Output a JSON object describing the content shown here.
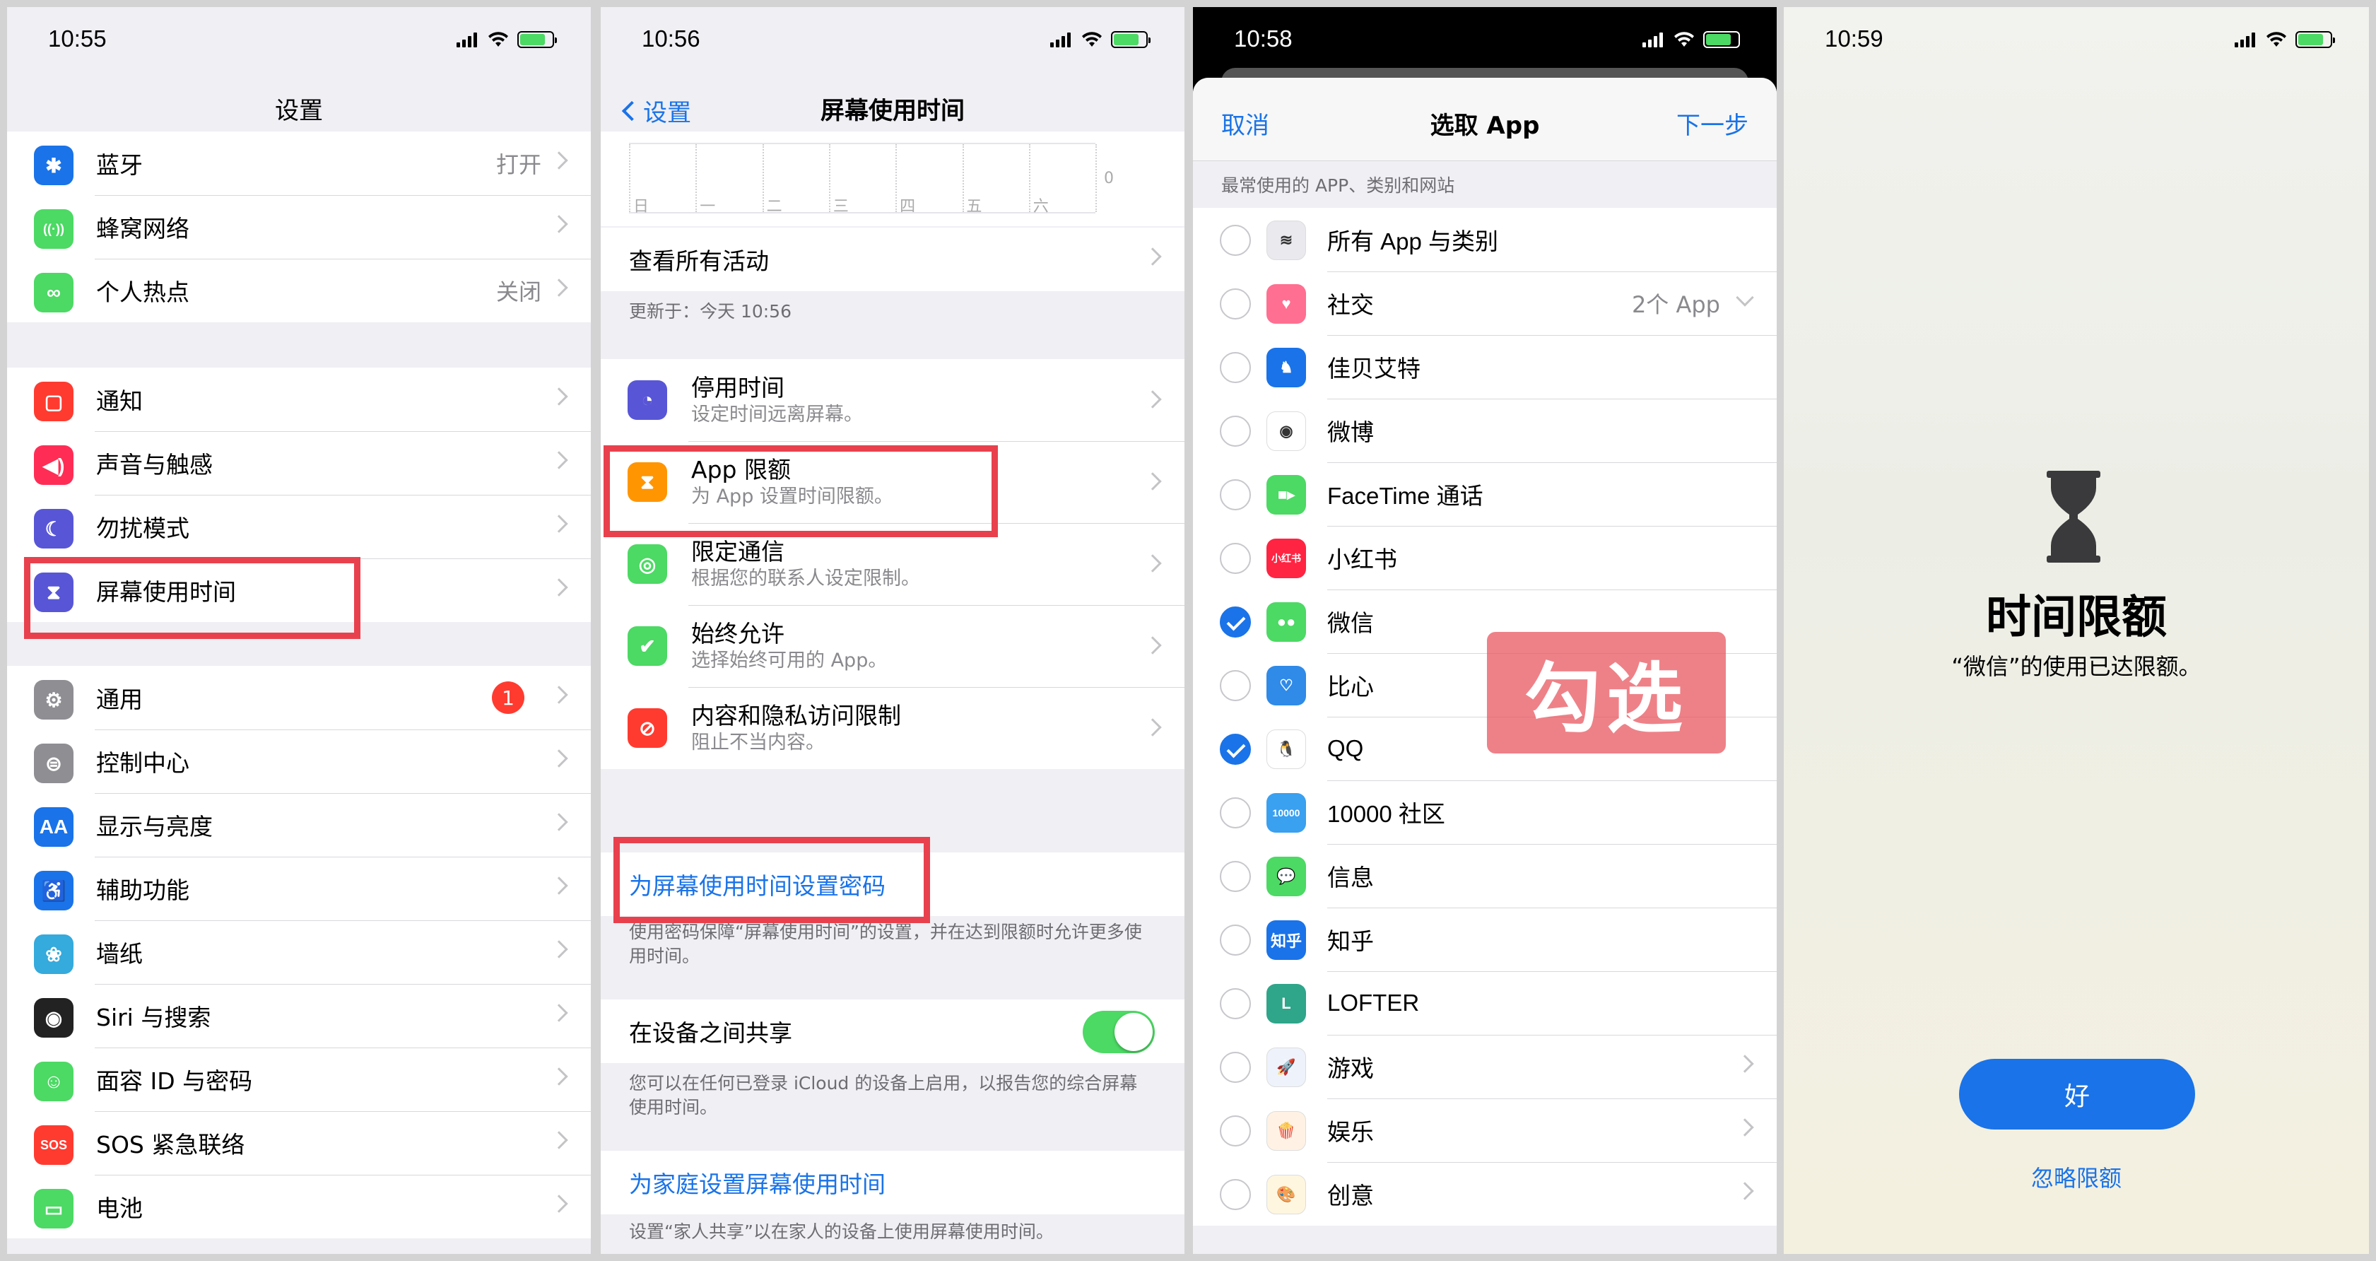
{
  "panel1": {
    "time": "10:55",
    "title": "设置",
    "group1": [
      {
        "label": "蓝牙",
        "value": "打开",
        "color": "#1a73e8",
        "icon": "bluetooth-icon",
        "glyph": "✱"
      },
      {
        "label": "蜂窝网络",
        "value": "",
        "color": "#4cd964",
        "icon": "cellular-icon",
        "glyph": "((·))"
      },
      {
        "label": "个人热点",
        "value": "关闭",
        "color": "#4cd964",
        "icon": "hotspot-icon",
        "glyph": "∞"
      }
    ],
    "group2": [
      {
        "label": "通知",
        "color": "#ff3b30",
        "icon": "notification-icon",
        "glyph": "▢"
      },
      {
        "label": "声音与触感",
        "color": "#ff2d55",
        "icon": "sound-icon",
        "glyph": "◀)"
      },
      {
        "label": "勿扰模式",
        "color": "#5856d6",
        "icon": "moon-icon",
        "glyph": "☾"
      },
      {
        "label": "屏幕使用时间",
        "color": "#5856d6",
        "icon": "hourglass-icon",
        "glyph": "⧗"
      }
    ],
    "group3": [
      {
        "label": "通用",
        "badge": "1",
        "color": "#8e8e93",
        "icon": "gear-icon",
        "glyph": "⚙"
      },
      {
        "label": "控制中心",
        "color": "#8e8e93",
        "icon": "control-center-icon",
        "glyph": "⊜"
      },
      {
        "label": "显示与亮度",
        "color": "#1a73e8",
        "icon": "display-icon",
        "glyph": "AA"
      },
      {
        "label": "辅助功能",
        "color": "#1a73e8",
        "icon": "accessibility-icon",
        "glyph": "♿"
      },
      {
        "label": "墙纸",
        "color": "#35aadc",
        "icon": "wallpaper-icon",
        "glyph": "❀"
      },
      {
        "label": "Siri 与搜索",
        "color": "#222",
        "icon": "siri-icon",
        "glyph": "◉"
      },
      {
        "label": "面容 ID 与密码",
        "color": "#4cd964",
        "icon": "faceid-icon",
        "glyph": "☺"
      },
      {
        "label": "SOS 紧急联络",
        "color": "#ff3b30",
        "icon": "sos-icon",
        "glyph": "SOS"
      },
      {
        "label": "电池",
        "color": "#4cd964",
        "icon": "battery-icon",
        "glyph": "▭"
      }
    ]
  },
  "panel2": {
    "time": "10:56",
    "back": "设置",
    "title": "屏幕使用时间",
    "zero": "0",
    "days": [
      "日",
      "一",
      "二",
      "三",
      "四",
      "五",
      "六"
    ],
    "see_all": "查看所有活动",
    "updated": "更新于：今天 10:56",
    "items": [
      {
        "title": "停用时间",
        "sub": "设定时间远离屏幕。",
        "color": "#5856d6",
        "icon": "downtime-icon",
        "glyph": "◔"
      },
      {
        "title": "App 限额",
        "sub": "为 App 设置时间限额。",
        "color": "#ff9500",
        "icon": "hourglass-icon",
        "glyph": "⧗"
      },
      {
        "title": "限定通信",
        "sub": "根据您的联系人设定限制。",
        "color": "#4cd964",
        "icon": "contact-icon",
        "glyph": "◎"
      },
      {
        "title": "始终允许",
        "sub": "选择始终可用的 App。",
        "color": "#4cd964",
        "icon": "check-shield-icon",
        "glyph": "✔"
      },
      {
        "title": "内容和隐私访问限制",
        "sub": "阻止不当内容。",
        "color": "#ff3b30",
        "icon": "restrict-icon",
        "glyph": "⊘"
      }
    ],
    "passcode": "为屏幕使用时间设置密码",
    "passcode_note": "使用密码保障“屏幕使用时间”的设置，并在达到限额时允许更多使用时间。",
    "share": "在设备之间共享",
    "share_note": "您可以在任何已登录 iCloud 的设备上启用，以报告您的综合屏幕使用时间。",
    "family": "为家庭设置屏幕使用时间",
    "family_note": "设置“家人共享”以在家人的设备上使用屏幕使用时间。"
  },
  "panel3": {
    "time": "10:58",
    "cancel": "取消",
    "title": "选取 App",
    "next": "下一步",
    "section": "最常使用的 APP、类别和网站",
    "overlay": "勾选",
    "apps": [
      {
        "label": "所有 App 与类别",
        "checked": false,
        "color": "#e9e9ee",
        "icon": "stack-icon",
        "glyph": "≋"
      },
      {
        "label": "社交",
        "value": "2个 App",
        "checked": false,
        "color": "#ff6f91",
        "icon": "social-icon",
        "glyph": "♥"
      },
      {
        "label": "佳贝艾特",
        "checked": false,
        "color": "#1a73e8",
        "icon": "goat-icon",
        "glyph": "♞"
      },
      {
        "label": "微博",
        "checked": false,
        "color": "#fff",
        "icon": "weibo-icon",
        "glyph": "◉"
      },
      {
        "label": "FaceTime 通话",
        "checked": false,
        "color": "#4cd964",
        "icon": "facetime-icon",
        "glyph": "■▸"
      },
      {
        "label": "小红书",
        "checked": false,
        "color": "#ff2442",
        "icon": "xiaohongshu-icon",
        "glyph": "小红书"
      },
      {
        "label": "微信",
        "checked": true,
        "color": "#4cd964",
        "icon": "wechat-icon",
        "glyph": "●●"
      },
      {
        "label": "比心",
        "checked": false,
        "color": "#2f8ae8",
        "icon": "bixin-icon",
        "glyph": "♡"
      },
      {
        "label": "QQ",
        "checked": true,
        "color": "#fff",
        "icon": "qq-icon",
        "glyph": "🐧"
      },
      {
        "label": "10000 社区",
        "checked": false,
        "color": "#3aa0f0",
        "icon": "community-icon",
        "glyph": "10000"
      },
      {
        "label": "信息",
        "checked": false,
        "color": "#4cd964",
        "icon": "messages-icon",
        "glyph": "💬"
      },
      {
        "label": "知乎",
        "checked": false,
        "color": "#1a73e8",
        "icon": "zhihu-icon",
        "glyph": "知乎"
      },
      {
        "label": "LOFTER",
        "checked": false,
        "color": "#2fa58a",
        "icon": "lofter-icon",
        "glyph": "L"
      },
      {
        "label": "游戏",
        "checked": false,
        "color": "#eef2fb",
        "icon": "rocket-icon",
        "glyph": "🚀",
        "chev": true
      },
      {
        "label": "娱乐",
        "checked": false,
        "color": "#fff2e5",
        "icon": "popcorn-icon",
        "glyph": "🍿",
        "chev": true
      },
      {
        "label": "创意",
        "checked": false,
        "color": "#fff6e0",
        "icon": "palette-icon",
        "glyph": "🎨",
        "chev": true
      }
    ]
  },
  "panel4": {
    "time": "10:59",
    "title": "时间限额",
    "message": "“微信”的使用已达限额。",
    "ok": "好",
    "ignore": "忽略限额"
  }
}
